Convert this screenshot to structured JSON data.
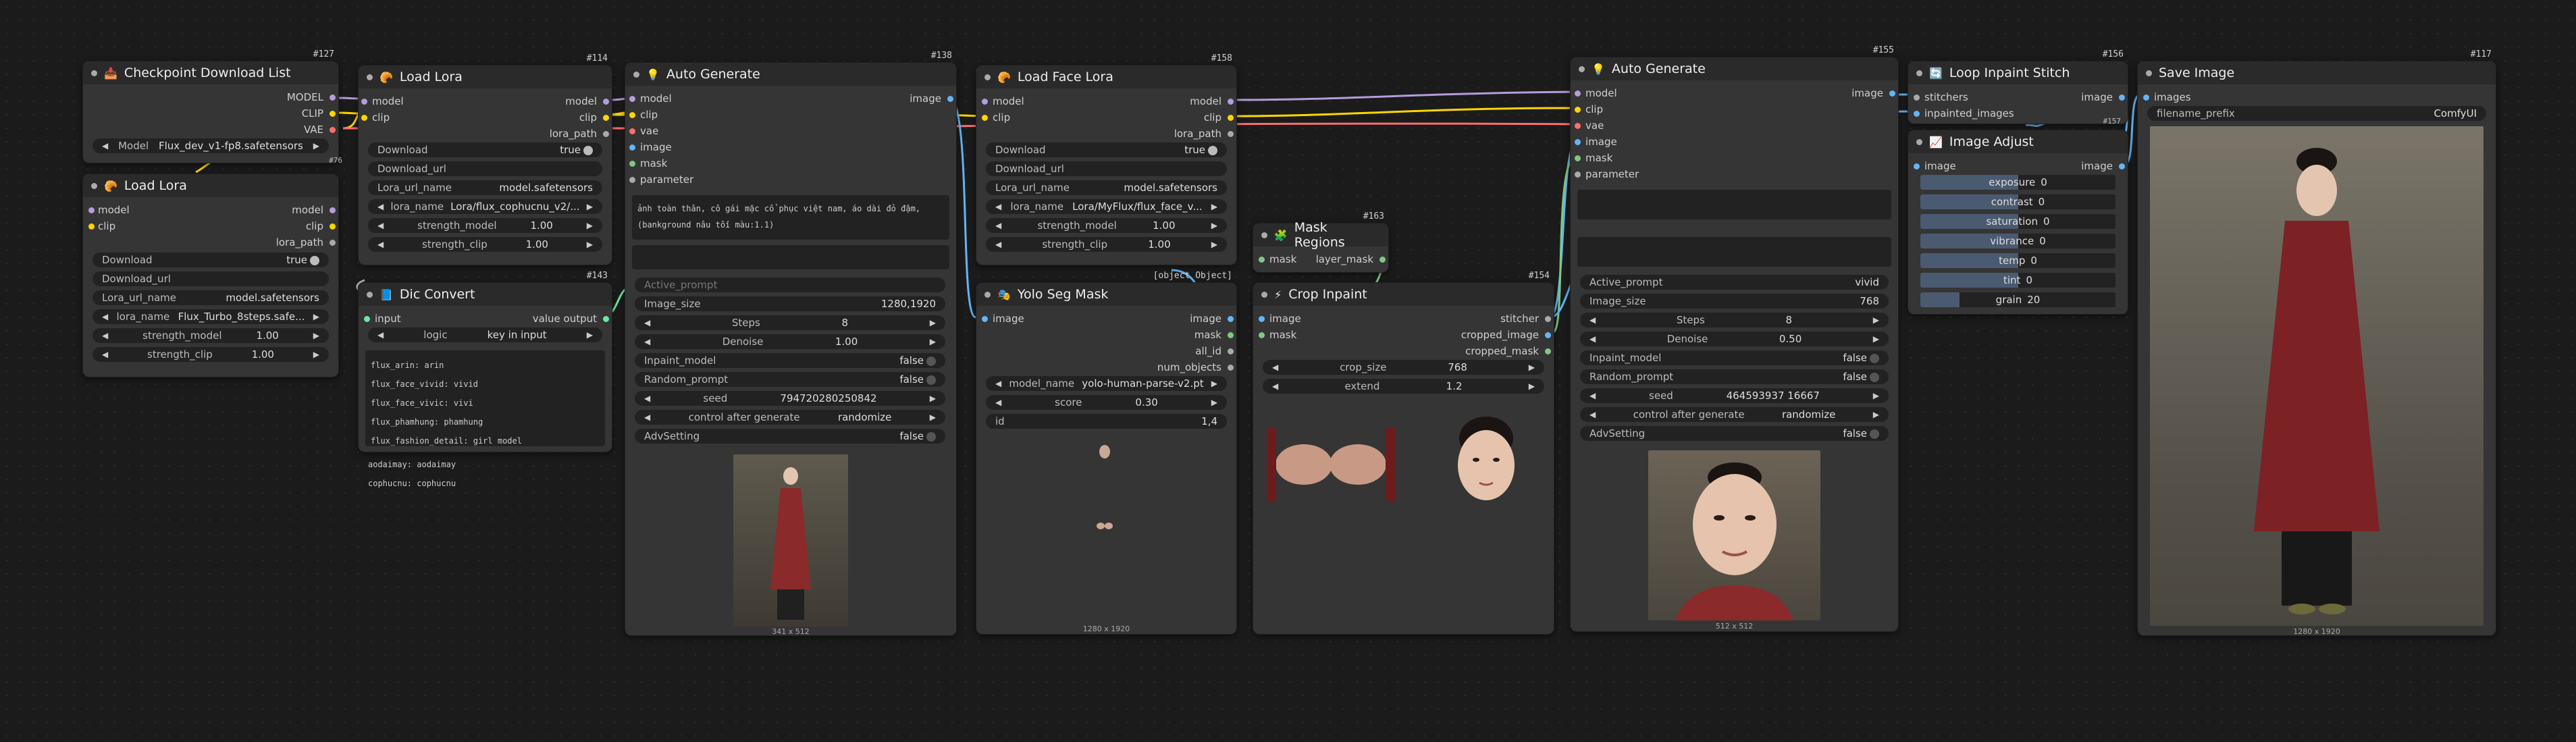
{
  "nodes": {
    "ckpt": {
      "id": "#127",
      "title": "Checkpoint Download List",
      "outputs": [
        "MODEL",
        "CLIP",
        "VAE"
      ],
      "widget": {
        "label": "Model",
        "value": "Flux_dev_v1-fp8.safetensors"
      },
      "badge": "#76"
    },
    "lora1": {
      "title": "Load Lora",
      "inputs": [
        "model",
        "clip"
      ],
      "outputs": [
        "model",
        "clip",
        "lora_path"
      ],
      "download": {
        "label": "Download",
        "value": "true"
      },
      "download_url": "Download_url",
      "lora_url_name": {
        "label": "Lora_url_name",
        "value": "model.safetensors"
      },
      "lora_name": {
        "label": "lora_name",
        "value": "Flux_Turbo_8steps.safe..."
      },
      "strength_model": {
        "label": "strength_model",
        "value": "1.00"
      },
      "strength_clip": {
        "label": "strength_clip",
        "value": "1.00"
      }
    },
    "lora2": {
      "id": "#114",
      "title": "Load Lora",
      "inputs": [
        "model",
        "clip"
      ],
      "outputs": [
        "model",
        "clip",
        "lora_path"
      ],
      "download": {
        "label": "Download",
        "value": "true"
      },
      "download_url": "Download_url",
      "lora_url_name": {
        "label": "Lora_url_name",
        "value": "model.safetensors"
      },
      "lora_name": {
        "label": "lora_name",
        "value": "Lora/flux_cophucnu_v2/..."
      },
      "strength_model": {
        "label": "strength_model",
        "value": "1.00"
      },
      "strength_clip": {
        "label": "strength_clip",
        "value": "1.00"
      }
    },
    "dic": {
      "id": "#143",
      "title": "Dic Convert",
      "input": "input",
      "output": "value output",
      "logic": {
        "label": "logic",
        "value": "key in input"
      },
      "lines": [
        "flux_arin: arin",
        "flux_face_vivid: vivid",
        "flux_face_vivic: vivi",
        "flux_phamhung: phamhung",
        "flux_fashion_detail: girl model",
        "aodaimay: aodaimay",
        "cophucnu: cophucnu"
      ]
    },
    "ag1": {
      "id": "#138",
      "title": "Auto Generate",
      "inputs": [
        "model",
        "clip",
        "vae",
        "image",
        "mask",
        "parameter"
      ],
      "output": "image",
      "prompt_lines": [
        "ảnh toàn thân, cô gái mặc cổ phục việt nam, áo dài đỏ đậm,",
        "(bankground nâu tối màu:1.1)"
      ],
      "active_prompt": "Active_prompt",
      "image_size": {
        "label": "Image_size",
        "value": "1280,1920"
      },
      "steps": {
        "label": "Steps",
        "value": "8"
      },
      "denoise": {
        "label": "Denoise",
        "value": "1.00"
      },
      "inpaint_model": {
        "label": "Inpaint_model",
        "value": "false"
      },
      "random_prompt": {
        "label": "Random_prompt",
        "value": "false"
      },
      "seed": {
        "label": "seed",
        "value": "794720280250842"
      },
      "control": {
        "label": "control after generate",
        "value": "randomize"
      },
      "adv": {
        "label": "AdvSetting",
        "value": "false"
      },
      "caption": "341 x 512"
    },
    "facelora": {
      "id": "#158",
      "title": "Load Face Lora",
      "inputs": [
        "model",
        "clip"
      ],
      "outputs": [
        "model",
        "clip",
        "lora_path"
      ],
      "download": {
        "label": "Download",
        "value": "true"
      },
      "download_url": "Download_url",
      "lora_url_name": {
        "label": "Lora_url_name",
        "value": "model.safetensors"
      },
      "lora_name": {
        "label": "lora_name",
        "value": "Lora/MyFlux/flux_face_v..."
      },
      "strength_model": {
        "label": "strength_model",
        "value": "1.00"
      },
      "strength_clip": {
        "label": "strength_clip",
        "value": "1.00"
      }
    },
    "yolo": {
      "id": {
        "label": "id",
        "value": "1,4"
      },
      "title": "Yolo Seg Mask",
      "input": "image",
      "outputs": [
        "image",
        "mask",
        "all_id",
        "num_objects"
      ],
      "model_name": {
        "label": "model_name",
        "value": "yolo-human-parse-v2.pt"
      },
      "score": {
        "label": "score",
        "value": "0.30"
      },
      "caption": "1280 x 1920"
    },
    "mask": {
      "id": "#163",
      "title": "Mask Regions",
      "input": "mask",
      "output": "layer_mask"
    },
    "crop": {
      "id": "#154",
      "title": "Crop Inpaint",
      "inputs": [
        "image",
        "mask"
      ],
      "outputs": [
        "stitcher",
        "cropped_image",
        "cropped_mask"
      ],
      "crop_size": {
        "label": "crop_size",
        "value": "768"
      },
      "extend": {
        "label": "extend",
        "value": "1.2"
      }
    },
    "ag2": {
      "id": "#155",
      "title": "Auto Generate",
      "inputs": [
        "model",
        "clip",
        "vae",
        "image",
        "mask",
        "parameter"
      ],
      "output": "image",
      "active_prompt": {
        "label": "Active_prompt",
        "value": "vivid"
      },
      "image_size": {
        "label": "Image_size",
        "value": "768"
      },
      "steps": {
        "label": "Steps",
        "value": "8"
      },
      "denoise": {
        "label": "Denoise",
        "value": "0.50"
      },
      "inpaint_model": {
        "label": "Inpaint_model",
        "value": "false"
      },
      "random_prompt": {
        "label": "Random_prompt",
        "value": "false"
      },
      "seed": {
        "label": "seed",
        "value": "464593937 16667"
      },
      "control": {
        "label": "control after generate",
        "value": "randomize"
      },
      "adv": {
        "label": "AdvSetting",
        "value": "false"
      },
      "caption": "512 x 512"
    },
    "stitch": {
      "id": "#156",
      "title": "Loop Inpaint Stitch",
      "inputs": [
        "stitchers",
        "inpainted_images"
      ],
      "output": "image",
      "badge": "#157"
    },
    "adjust": {
      "title": "Image Adjust",
      "input": "image",
      "output": "image",
      "params": [
        {
          "label": "exposure",
          "value": "0"
        },
        {
          "label": "contrast",
          "value": "0"
        },
        {
          "label": "saturation",
          "value": "0"
        },
        {
          "label": "vibrance",
          "value": "0"
        },
        {
          "label": "temp",
          "value": "0"
        },
        {
          "label": "tint",
          "value": "0"
        },
        {
          "label": "grain",
          "value": "20"
        }
      ],
      "fills": [
        0.5,
        0.5,
        0.5,
        0.5,
        0.5,
        0.5,
        0.2
      ]
    },
    "save": {
      "id": "#117",
      "title": "Save Image",
      "input": "images",
      "prefix": {
        "label": "filename_prefix",
        "value": "ComfyUI"
      },
      "caption": "1280 x 1920"
    }
  },
  "colors": {
    "model": "#b39ddb",
    "clip": "#ffd500",
    "vae": "#ff6e6e",
    "image": "#64b5f6",
    "mask": "#81c784",
    "lora": "#aaaaaa",
    "string": "#6ee7a0"
  },
  "icons": {
    "ckpt": "download-icon",
    "lora": "lora-icon",
    "dic": "dictionary-icon",
    "ag": "bulb-icon",
    "mask": "puzzle-icon",
    "crop": "crop-icon",
    "stitch": "stitch-icon",
    "adjust": "adjust-icon"
  }
}
